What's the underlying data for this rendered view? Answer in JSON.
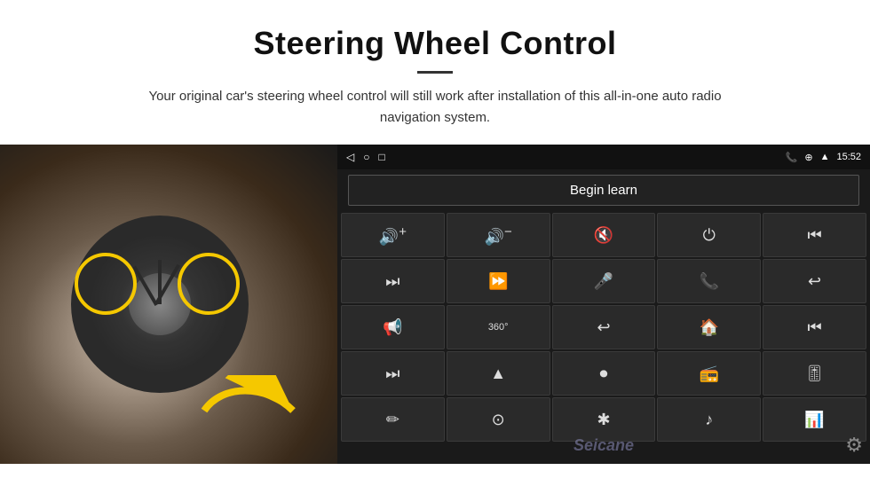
{
  "header": {
    "title": "Steering Wheel Control",
    "divider": true,
    "subtitle": "Your original car's steering wheel control will still work after installation of this all-in-one auto radio navigation system."
  },
  "android_screen": {
    "status_bar": {
      "back_icon": "◁",
      "home_icon": "○",
      "recents_icon": "□",
      "signal_icon": "▣▐",
      "phone_icon": "📞",
      "location_icon": "⊕",
      "wifi_icon": "▲",
      "time": "15:52"
    },
    "begin_learn_label": "Begin learn",
    "controls": [
      {
        "icon": "🔊+",
        "label": "vol-up"
      },
      {
        "icon": "🔊−",
        "label": "vol-down"
      },
      {
        "icon": "🔇",
        "label": "mute"
      },
      {
        "icon": "⏻",
        "label": "power"
      },
      {
        "icon": "⏮",
        "label": "prev"
      },
      {
        "icon": "⏭",
        "label": "next"
      },
      {
        "icon": "⏩⏩",
        "label": "fast-forward"
      },
      {
        "icon": "🎤",
        "label": "mic"
      },
      {
        "icon": "📞",
        "label": "call"
      },
      {
        "icon": "↩",
        "label": "hang-up"
      },
      {
        "icon": "📢",
        "label": "horn"
      },
      {
        "icon": "360°",
        "label": "360-cam"
      },
      {
        "icon": "↩",
        "label": "back"
      },
      {
        "icon": "🏠",
        "label": "home"
      },
      {
        "icon": "⏮⏮",
        "label": "prev-track"
      },
      {
        "icon": "⏭",
        "label": "next-track"
      },
      {
        "icon": "▲",
        "label": "nav"
      },
      {
        "icon": "⏺",
        "label": "source"
      },
      {
        "icon": "📻",
        "label": "radio"
      },
      {
        "icon": "🎚",
        "label": "eq"
      },
      {
        "icon": "✏",
        "label": "custom1"
      },
      {
        "icon": "⊙",
        "label": "custom2"
      },
      {
        "icon": "✱",
        "label": "bluetooth"
      },
      {
        "icon": "♪",
        "label": "music"
      },
      {
        "icon": "📊",
        "label": "equalizer"
      }
    ],
    "watermark": "Seicane",
    "gear_icon": "⚙"
  },
  "steering_wheel": {
    "arrow_color": "#f5c800"
  }
}
